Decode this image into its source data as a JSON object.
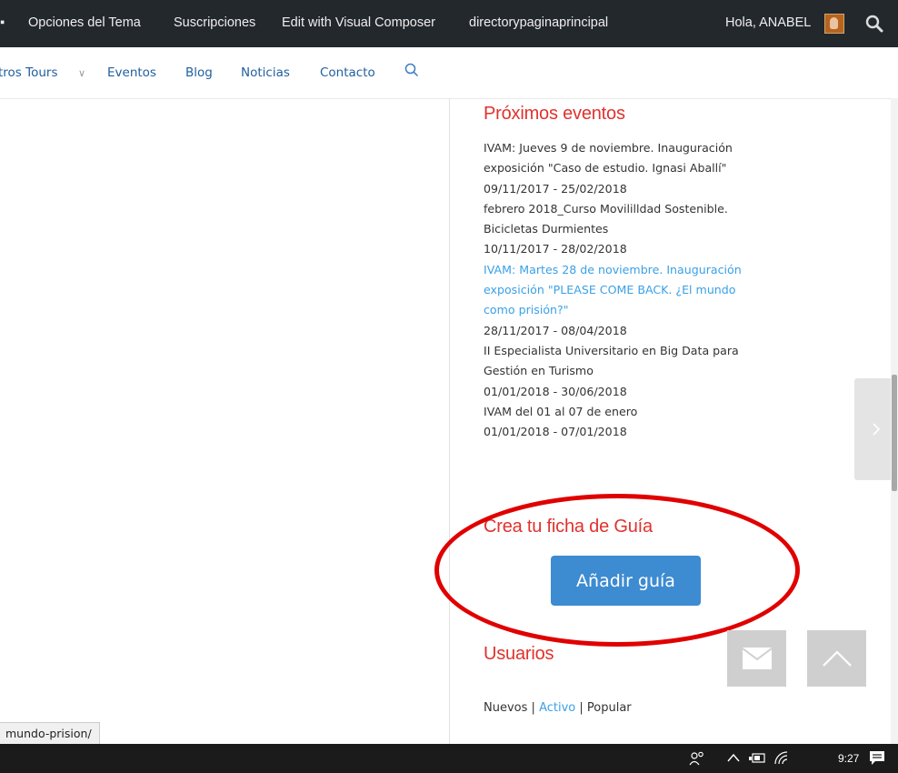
{
  "admin_bar": {
    "items": [
      "Opciones del Tema",
      "Suscripciones",
      "Edit with Visual Composer",
      "directorypaginaprincipal"
    ],
    "greeting": "Hola, ANABEL"
  },
  "nav": {
    "items": [
      "tros Tours",
      "Eventos",
      "Blog",
      "Noticias",
      "Contacto"
    ]
  },
  "sidebar": {
    "events_title": "Próximos eventos",
    "events": [
      {
        "text": "IVAM: Jueves 9 de noviembre. Inauguración exposición \"Caso de estudio. Ignasi Aballí\"",
        "link": false
      },
      {
        "text": "09/11/2017 - 25/02/2018",
        "link": false
      },
      {
        "text": "febrero 2018_Curso Movililldad Sostenible. Bicicletas Durmientes",
        "link": false
      },
      {
        "text": "10/11/2017 - 28/02/2018",
        "link": false
      },
      {
        "text": "IVAM: Martes 28 de noviembre. Inauguración exposición \"PLEASE COME BACK. ¿El mundo como prisión?\"",
        "link": true
      },
      {
        "text": "28/11/2017 - 08/04/2018",
        "link": false
      },
      {
        "text": "II Especialista Universitario en Big Data para Gestión en Turismo",
        "link": false
      },
      {
        "text": "01/01/2018 - 30/06/2018",
        "link": false
      },
      {
        "text": "IVAM del 01 al 07 de enero",
        "link": false
      },
      {
        "text": "01/01/2018 - 07/01/2018",
        "link": false
      }
    ],
    "guide_title": "Crea tu ficha de Guía",
    "add_guide_label": "Añadir guía",
    "users_title": "Usuarios",
    "users_tabs": {
      "new": "Nuevos",
      "sep": "|",
      "active": "Activo",
      "popular": "Popular"
    }
  },
  "status_bar": {
    "url": "mundo-prision/"
  },
  "taskbar": {
    "time": "9:27"
  },
  "colors": {
    "accent_red": "#e0322d",
    "link_blue": "#3aa0e6",
    "button_blue": "#3d8bd1",
    "highlight_circle": "#e00000"
  }
}
